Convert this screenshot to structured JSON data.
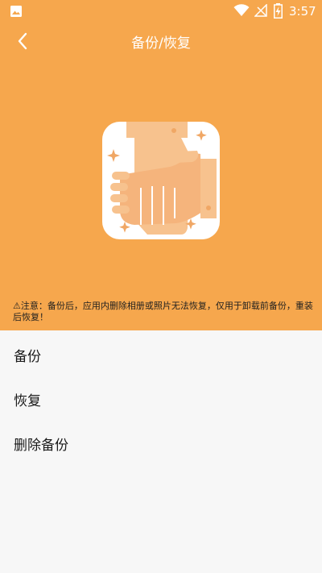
{
  "status_bar": {
    "time": "3:57",
    "icons": [
      "image-icon",
      "wifi-icon",
      "signal-icon",
      "battery-charging-icon"
    ]
  },
  "header": {
    "title": "备份/恢复",
    "back_icon": "chevron-left-icon",
    "illustration": "handshake-illustration",
    "notice": "⚠注意：备份后，应用内删除相册或照片无法恢复，仅用于卸载前备份，重装后恢复！"
  },
  "menu": {
    "items": [
      {
        "label": "备份"
      },
      {
        "label": "恢复"
      },
      {
        "label": "删除备份"
      }
    ]
  },
  "colors": {
    "header_bg": "#f6a74d",
    "body_bg": "#f7f7f7",
    "illustration_light": "#f7c28e",
    "illustration_dark": "#f0a765"
  }
}
